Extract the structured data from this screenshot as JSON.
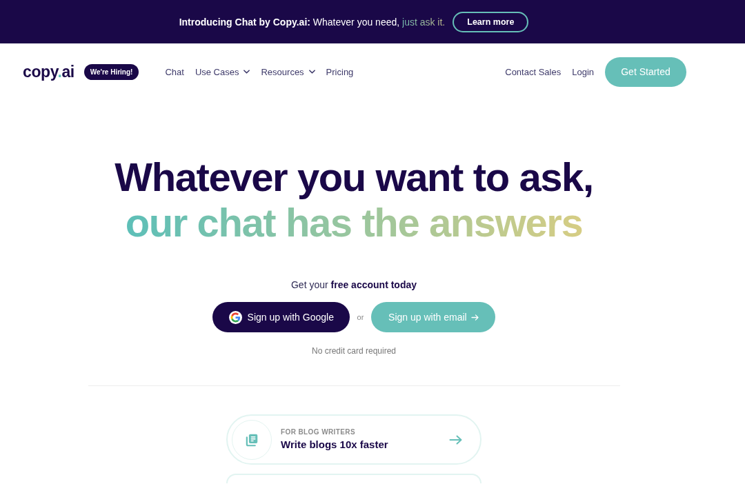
{
  "banner": {
    "lead": "Introducing Chat by Copy.ai:",
    "text": "Whatever you need,",
    "highlight": "just ask it.",
    "button": "Learn more"
  },
  "header": {
    "logo": {
      "text": "copy",
      "accent": ".",
      "suffix": "ai"
    },
    "badge": "We're Hiring!",
    "nav": [
      {
        "label": "Chat",
        "kind": "link"
      },
      {
        "label": "Use Cases",
        "kind": "dropdown"
      },
      {
        "label": "Resources",
        "kind": "dropdown"
      },
      {
        "label": "Pricing",
        "kind": "link"
      }
    ],
    "actions": [
      {
        "label": "Contact Sales",
        "kind": "link"
      },
      {
        "label": "Login",
        "kind": "link"
      },
      {
        "label": "Get Started",
        "kind": "button"
      }
    ]
  },
  "hero": {
    "title": "Whatever you want to ask,",
    "subtitle": "our chat has the answers",
    "prompt": "Get your **free account today**",
    "google_button": "Sign up with Google",
    "separator": "or",
    "email_button": "Sign up with email",
    "note": "No credit card required"
  },
  "cards": [
    {
      "eyebrow": "FOR BLOG WRITERS",
      "title": "Write blogs 10x faster"
    }
  ]
}
